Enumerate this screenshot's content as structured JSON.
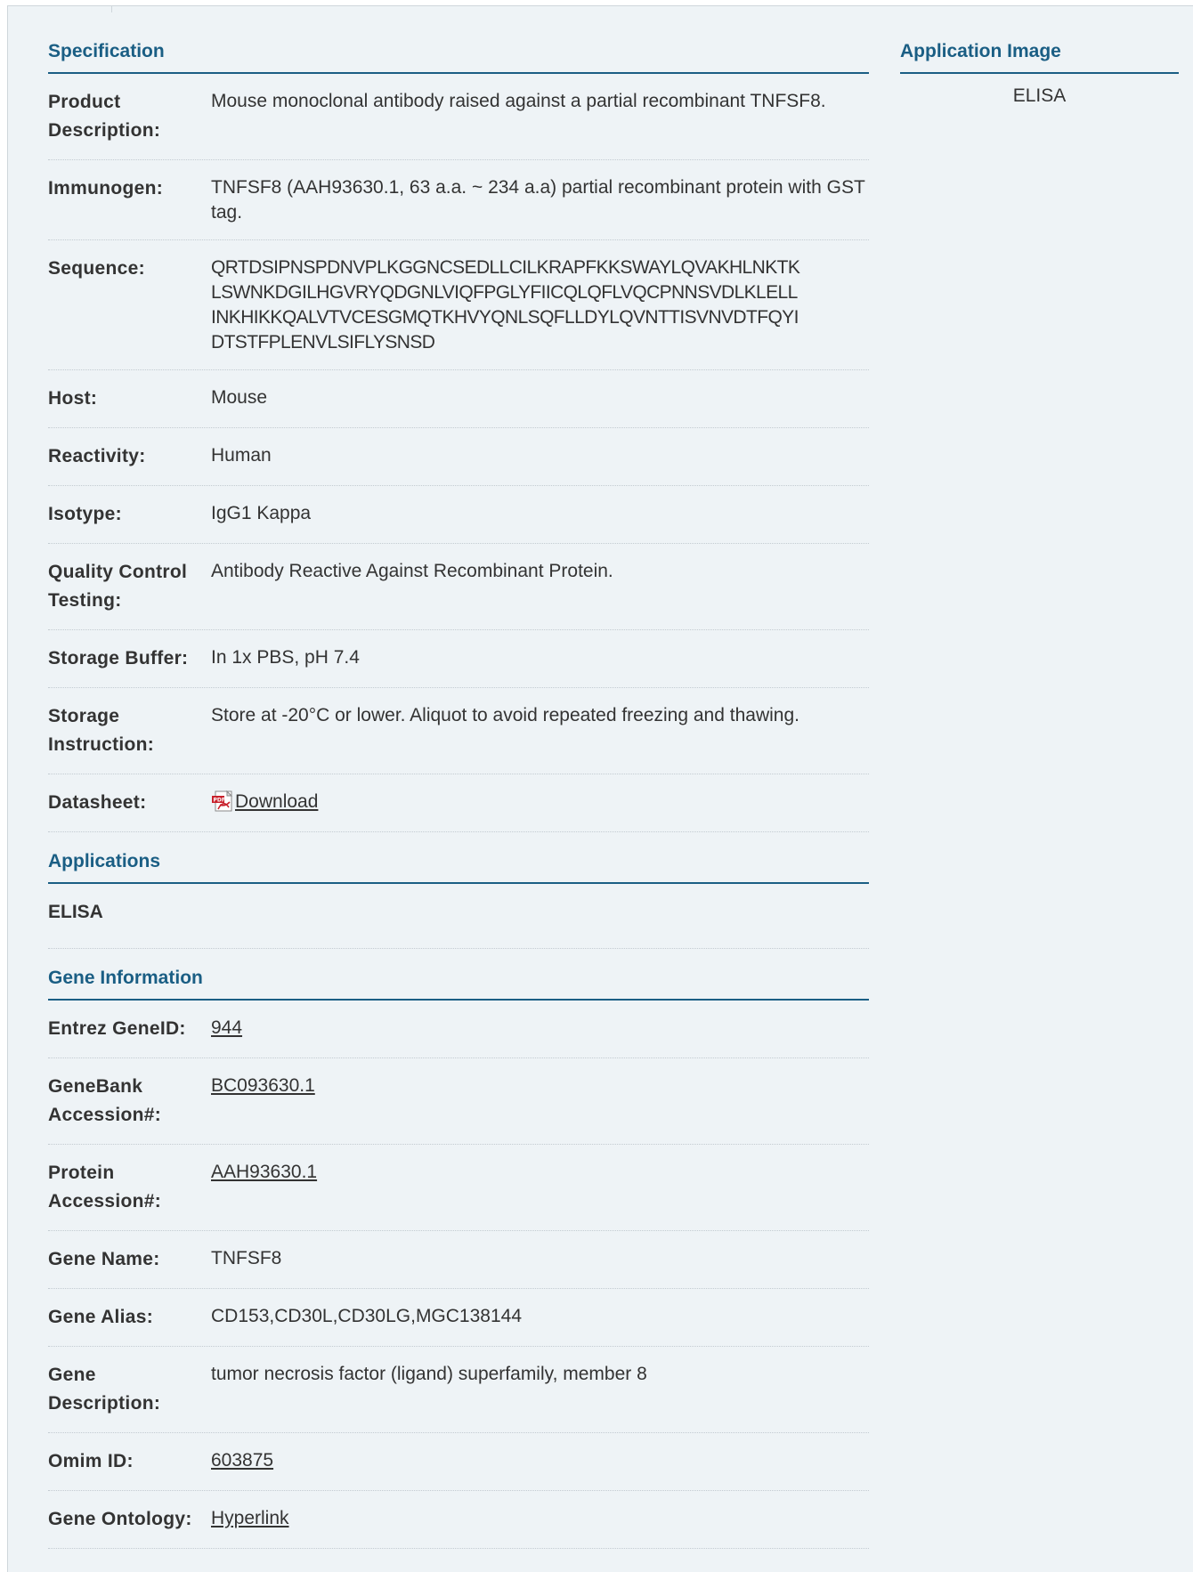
{
  "specification": {
    "title": "Specification",
    "rows": [
      {
        "label": "Product Description:",
        "value": "Mouse monoclonal antibody raised against a partial recombinant TNFSF8."
      },
      {
        "label": "Immunogen:",
        "value": "TNFSF8 (AAH93630.1, 63 a.a. ~ 234 a.a) partial recombinant protein with GST tag."
      },
      {
        "label": "Sequence:",
        "lines": [
          "QRTDSIPNSPDNVPLKGGNCSEDLLCILKRAPFKKSWAYLQVAKHLNKTK",
          "LSWNKDGILHGVRYQDGNLVIQFPGLYFIICQLQFLVQCPNNSVDLKLELL",
          "INKHIKKQALVTVCESGMQTKHVYQNLSQFLLDYLQVNTTISVNVDTFQYI",
          "DTSTFPLENVLSIFLYSNSD"
        ]
      },
      {
        "label": "Host:",
        "value": "Mouse"
      },
      {
        "label": "Reactivity:",
        "value": "Human"
      },
      {
        "label": "Isotype:",
        "value": "IgG1 Kappa"
      },
      {
        "label": "Quality Control Testing:",
        "value": "Antibody Reactive Against Recombinant Protein."
      },
      {
        "label": "Storage Buffer:",
        "value": "In 1x PBS, pH 7.4"
      },
      {
        "label": "Storage Instruction:",
        "value": "Store at -20°C or lower. Aliquot to avoid repeated freezing and thawing."
      },
      {
        "label": "Datasheet:",
        "link": "Download",
        "icon": "pdf-icon"
      }
    ]
  },
  "applications": {
    "title": "Applications",
    "items": [
      "ELISA"
    ]
  },
  "gene_information": {
    "title": "Gene Information",
    "rows": [
      {
        "label": "Entrez GeneID:",
        "link": "944"
      },
      {
        "label": "GeneBank Accession#:",
        "link": "BC093630.1"
      },
      {
        "label": "Protein Accession#:",
        "link": "AAH93630.1"
      },
      {
        "label": "Gene Name:",
        "value": "TNFSF8"
      },
      {
        "label": "Gene Alias:",
        "value": "CD153,CD30L,CD30LG,MGC138144"
      },
      {
        "label": "Gene Description:",
        "value": "tumor necrosis factor (ligand) superfamily, member 8"
      },
      {
        "label": "Omim ID:",
        "link": "603875"
      },
      {
        "label": "Gene Ontology:",
        "link": "Hyperlink"
      }
    ]
  },
  "application_image": {
    "title": "Application Image",
    "label": "ELISA"
  },
  "colors": {
    "heading": "#1a5e84",
    "background": "#eef3f6",
    "text": "#333333"
  }
}
